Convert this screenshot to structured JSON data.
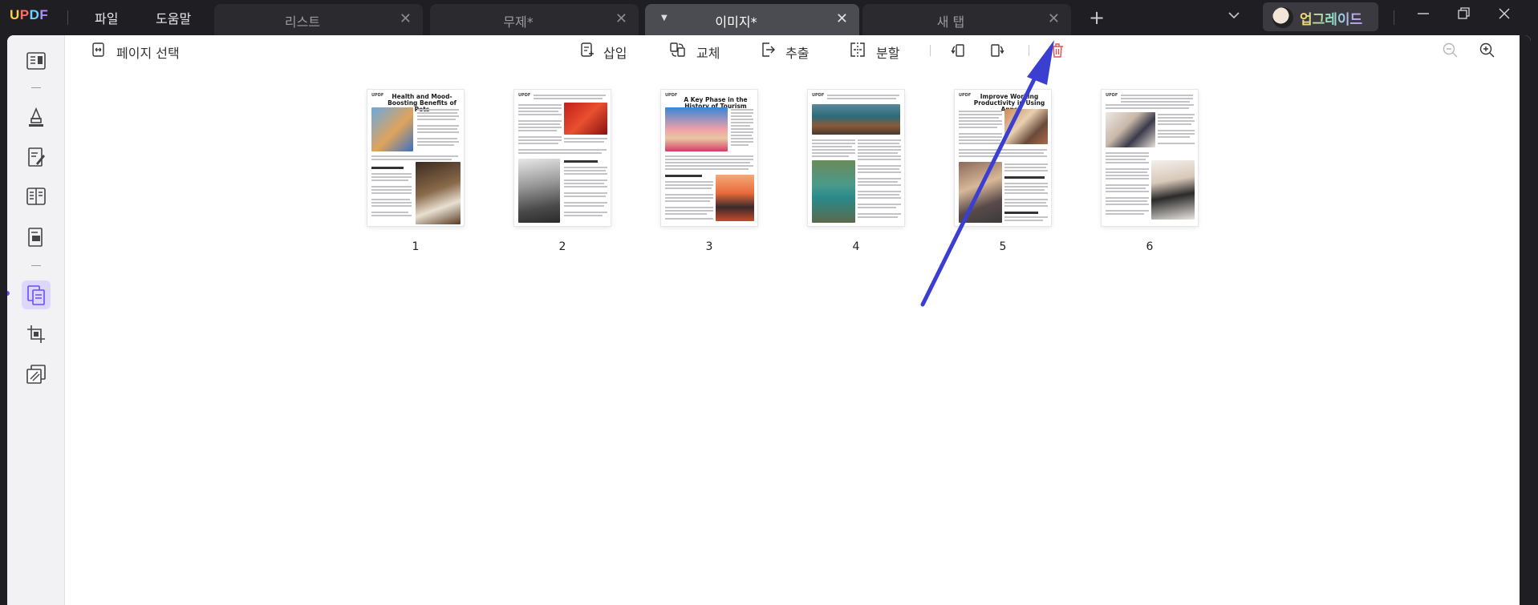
{
  "app": {
    "logo": "UPDF",
    "menus": [
      "파일",
      "도움말"
    ],
    "tabs": [
      {
        "label": "리스트",
        "active": false
      },
      {
        "label": "무제*",
        "active": false
      },
      {
        "label": "이미지*",
        "active": true
      },
      {
        "label": "새 탭",
        "active": false
      }
    ],
    "upgrade_label": "업그레이드"
  },
  "toolbar": {
    "select_pages": "페이지 선택",
    "insert": "삽입",
    "replace": "교체",
    "extract": "추출",
    "split": "분할"
  },
  "pages": [
    {
      "number": "1",
      "title": "Health and Mood-Boosting Benefits of Pets"
    },
    {
      "number": "2",
      "title": ""
    },
    {
      "number": "3",
      "title": "A Key Phase in the History of Tourism"
    },
    {
      "number": "4",
      "title": ""
    },
    {
      "number": "5",
      "title": "Improve Working Productivity in Using Apps"
    },
    {
      "number": "6",
      "title": ""
    }
  ],
  "colors": {
    "accent": "#6a4cff",
    "delete_icon": "#e84a4a",
    "arrow": "#3b3fd1"
  }
}
